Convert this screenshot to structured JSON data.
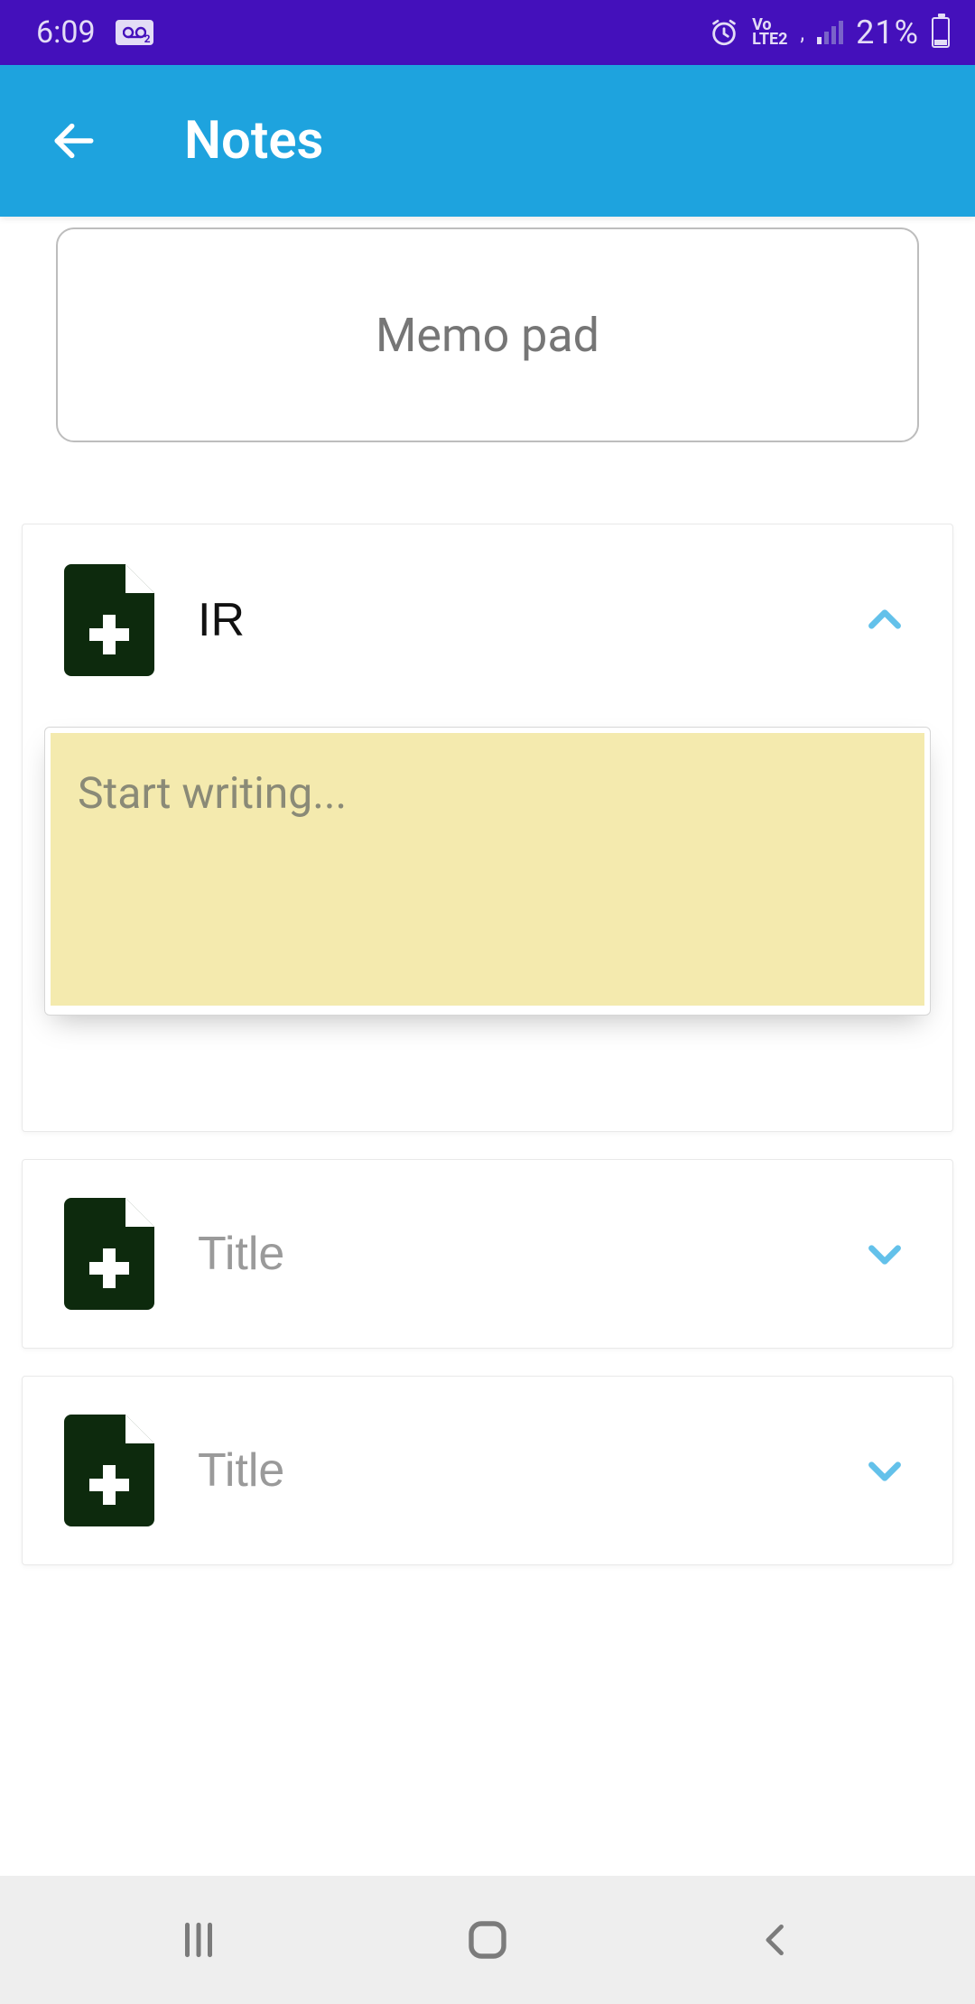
{
  "status": {
    "time": "6:09",
    "volte": "Vo\nLTE2",
    "battery_pct": "21%"
  },
  "header": {
    "title": "Notes"
  },
  "memo": {
    "placeholder": "Memo pad",
    "value": ""
  },
  "notes": [
    {
      "title_value": "IR",
      "title_placeholder": "Title",
      "expanded": true,
      "body_value": "",
      "body_placeholder": "Start writing..."
    },
    {
      "title_value": "",
      "title_placeholder": "Title",
      "expanded": false
    },
    {
      "title_value": "",
      "title_placeholder": "Title",
      "expanded": false
    }
  ],
  "colors": {
    "status_bg": "#4410bb",
    "appbar_bg": "#1ea3de",
    "note_bg": "#f4eaae",
    "icon_fill": "#0d2a0d",
    "chevron": "#63c1ea"
  }
}
